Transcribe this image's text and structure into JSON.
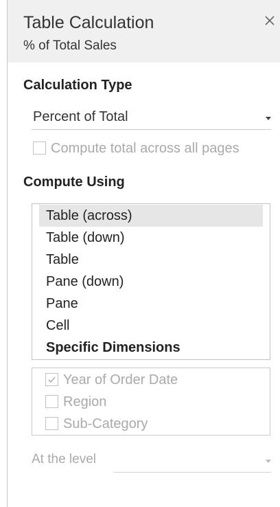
{
  "header": {
    "title": "Table Calculation",
    "subtitle": "% of Total Sales",
    "close_icon": "close-icon"
  },
  "calculation_type": {
    "heading": "Calculation Type",
    "selected": "Percent of Total",
    "compute_total_label": "Compute total across all pages",
    "compute_total_checked": false
  },
  "compute_using": {
    "heading": "Compute Using",
    "options": [
      {
        "label": "Table (across)",
        "selected": true
      },
      {
        "label": "Table (down)",
        "selected": false
      },
      {
        "label": "Table",
        "selected": false
      },
      {
        "label": "Pane (down)",
        "selected": false
      },
      {
        "label": "Pane",
        "selected": false
      },
      {
        "label": "Cell",
        "selected": false
      },
      {
        "label": "Specific Dimensions",
        "selected": false
      }
    ]
  },
  "dimensions": [
    {
      "label": "Year of Order Date",
      "checked": true
    },
    {
      "label": "Region",
      "checked": false
    },
    {
      "label": "Sub-Category",
      "checked": false
    }
  ],
  "level": {
    "label": "At the level",
    "value": ""
  },
  "colors": {
    "header_bg": "#f0f0f0",
    "selected_row_bg": "#e6e6e6",
    "disabled_text": "#aaaaaa"
  }
}
